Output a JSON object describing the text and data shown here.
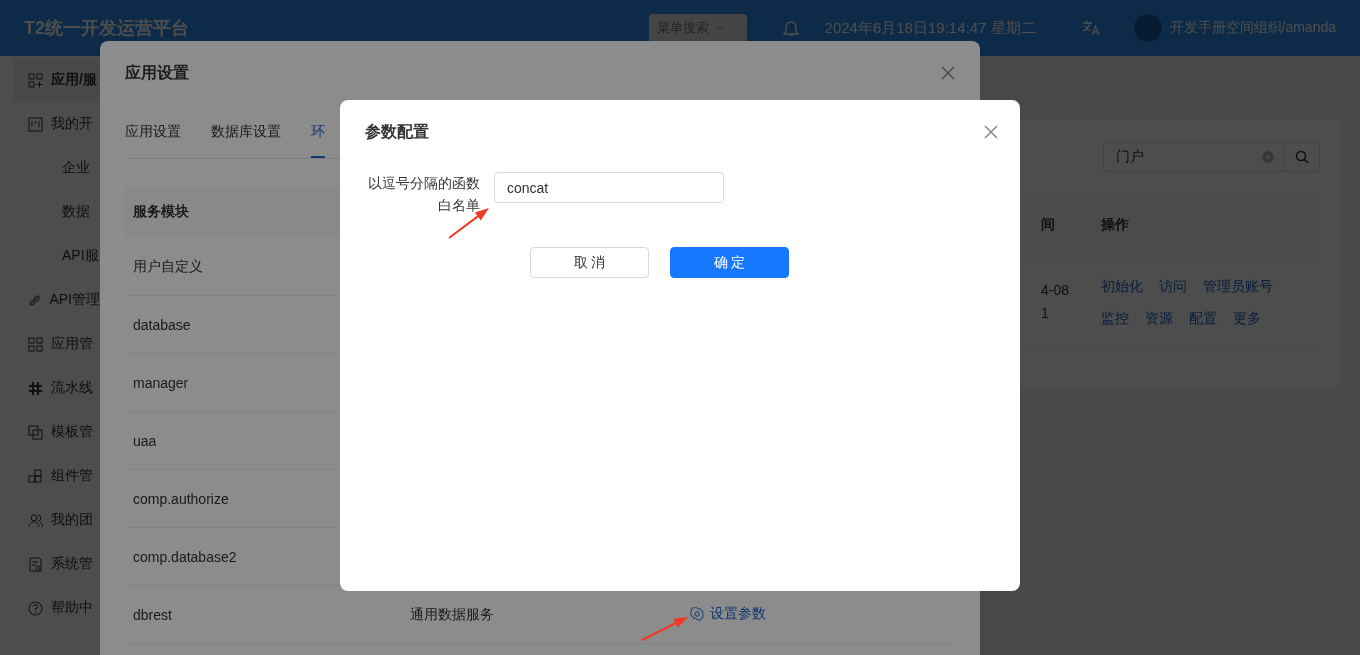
{
  "header": {
    "title": "T2统一开发运营平台",
    "menu_search": {
      "placeholder": "菜单搜索"
    },
    "datetime": "2024年6月18日19:14:47 星期二",
    "user": "开发手册空间组织/amanda"
  },
  "sidebar": {
    "items": [
      {
        "label": "应用/服",
        "selected": true
      },
      {
        "label": "我的开",
        "selected": false,
        "children": [
          {
            "label": "企业",
            "selected": false
          },
          {
            "label": "数据",
            "selected": false
          },
          {
            "label": "API服",
            "selected": false
          }
        ]
      },
      {
        "label": "API管理",
        "selected": false
      },
      {
        "label": "应用管",
        "selected": false
      },
      {
        "label": "流水线",
        "selected": false
      },
      {
        "label": "模板管",
        "selected": false
      },
      {
        "label": "组件管",
        "selected": false
      },
      {
        "label": "我的团",
        "selected": false
      },
      {
        "label": "系统管",
        "selected": false
      },
      {
        "label": "帮助中",
        "selected": false
      }
    ]
  },
  "main": {
    "search": {
      "value": "门户"
    },
    "table": {
      "columns": [
        "间",
        "操作"
      ],
      "rows": [
        {
          "column_1": [
            "4-08",
            "1"
          ],
          "actions": [
            [
              "初始化",
              "访问",
              "管理员账号"
            ],
            [
              "监控",
              "资源",
              "配置",
              "更多"
            ]
          ]
        }
      ]
    }
  },
  "settings_dialog": {
    "title": "应用设置",
    "tabs": [
      {
        "label": "应用设置",
        "selected": false
      },
      {
        "label": "数据库设置",
        "selected": false
      },
      {
        "label": "环",
        "selected": true
      }
    ],
    "table": {
      "columns": [
        "服务模块"
      ],
      "rows": [
        {
          "module": "用户自定义"
        },
        {
          "module": "database"
        },
        {
          "module": "manager"
        },
        {
          "module": "uaa"
        },
        {
          "module": "comp.authorize"
        },
        {
          "module": "comp.database2"
        },
        {
          "module": "dbrest",
          "description": "通用数据服务",
          "action": "设置参数"
        }
      ]
    }
  },
  "param_dialog": {
    "title": "参数配置",
    "fields": [
      {
        "label": "以逗号分隔的函数白名单",
        "value": "concat"
      }
    ],
    "buttons": [
      {
        "label": "取 消",
        "kind": "default"
      },
      {
        "label": "确 定",
        "kind": "primary"
      }
    ]
  },
  "annotations": [
    {
      "kind": "arrow"
    },
    {
      "kind": "arrow"
    }
  ]
}
